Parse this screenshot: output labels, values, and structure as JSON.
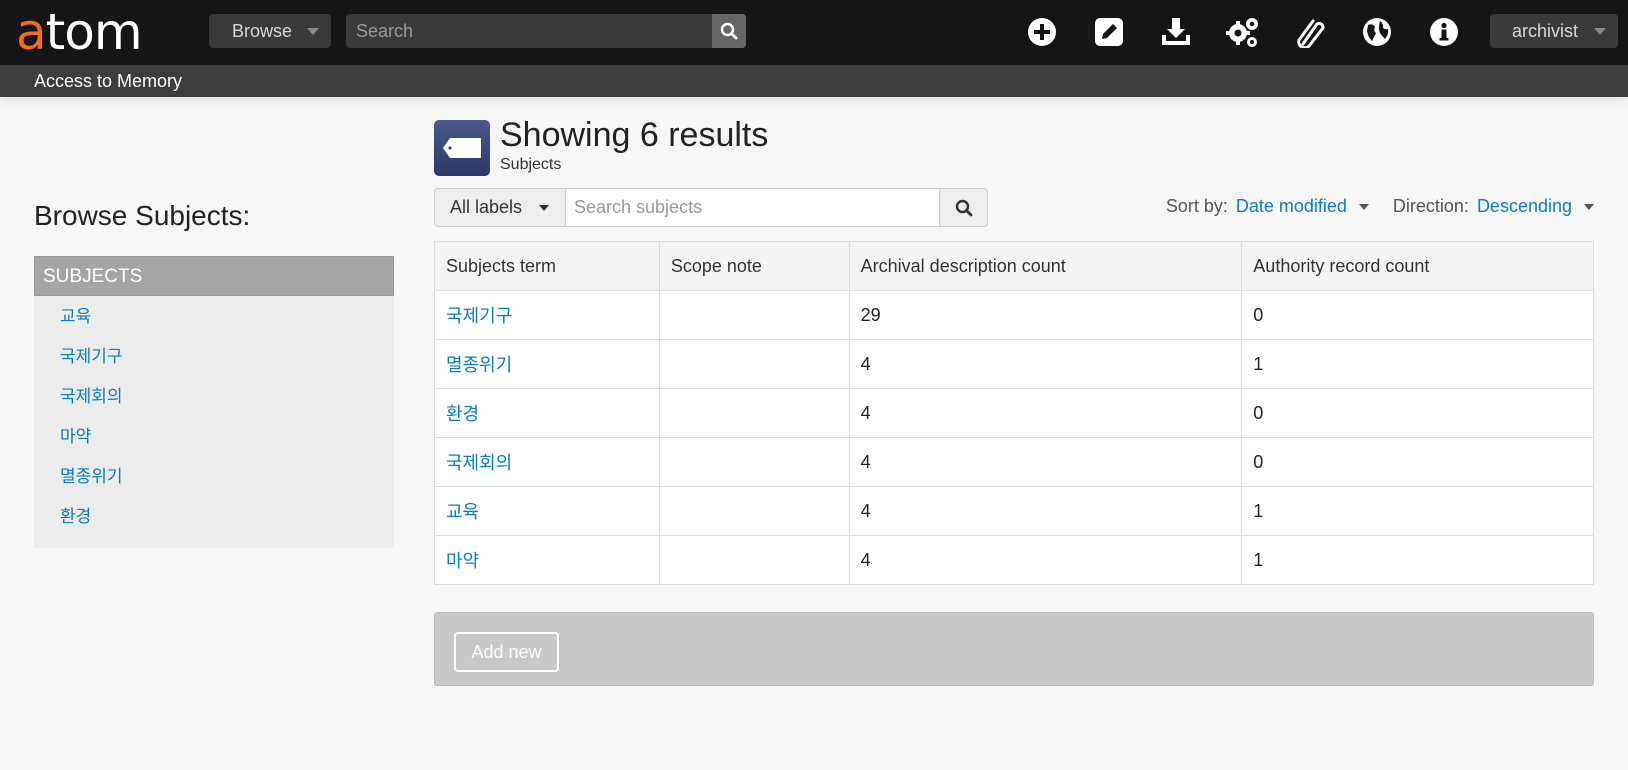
{
  "header": {
    "logo": {
      "first": "a",
      "rest": "tom"
    },
    "browse_label": "Browse",
    "search_placeholder": "Search",
    "icons": [
      "plus-circle-icon",
      "edit-icon",
      "import-icon",
      "gears-icon",
      "clipboard-icon",
      "globe-icon",
      "info-icon"
    ],
    "user_label": "archivist",
    "site_title": "Access to Memory"
  },
  "sidebar": {
    "heading": "Browse Subjects:",
    "facet_title": "SUBJECTS",
    "items": [
      "교육",
      "국제기구",
      "국제회의",
      "마약",
      "멸종위기",
      "환경"
    ]
  },
  "main": {
    "title": "Showing 6 results",
    "subtitle": "Subjects",
    "labels_button": "All labels",
    "search_placeholder": "Search subjects",
    "sort_label": "Sort by:",
    "sort_value": "Date modified",
    "direction_label": "Direction:",
    "direction_value": "Descending",
    "columns": [
      "Subjects term",
      "Scope note",
      "Archival description count",
      "Authority record count"
    ],
    "rows": [
      {
        "term": "국제기구",
        "scope": "",
        "desc_count": "29",
        "auth_count": "0"
      },
      {
        "term": "멸종위기",
        "scope": "",
        "desc_count": "4",
        "auth_count": "1"
      },
      {
        "term": "환경",
        "scope": "",
        "desc_count": "4",
        "auth_count": "0"
      },
      {
        "term": "국제회의",
        "scope": "",
        "desc_count": "4",
        "auth_count": "0"
      },
      {
        "term": "교육",
        "scope": "",
        "desc_count": "4",
        "auth_count": "1"
      },
      {
        "term": "마약",
        "scope": "",
        "desc_count": "4",
        "auth_count": "1"
      }
    ],
    "add_new_label": "Add new"
  },
  "colors": {
    "accent": "#0a7dbf",
    "logo_orange": "#f36d21",
    "topbar": "#151515",
    "subbar": "#3d3d3d"
  }
}
